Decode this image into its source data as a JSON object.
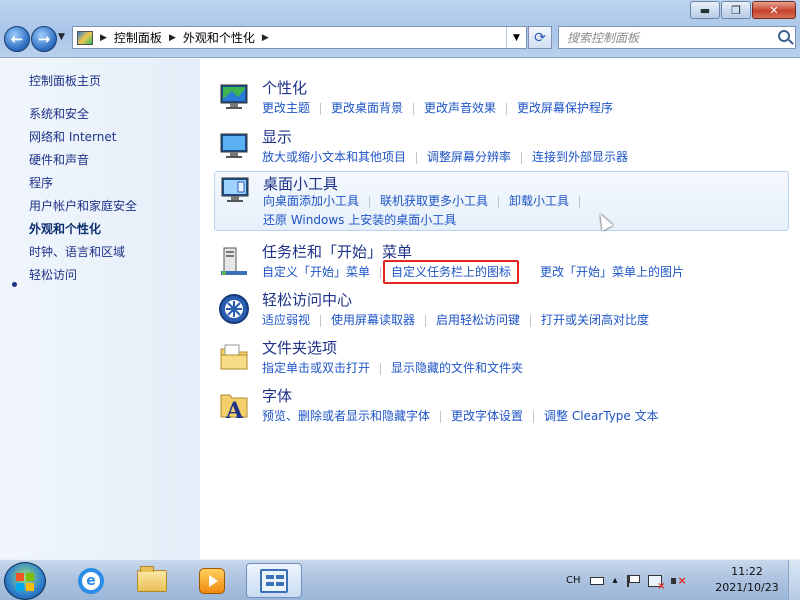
{
  "window": {
    "minimize": "▬",
    "maximize": "❐",
    "close": "✕"
  },
  "address": {
    "breadcrumb": [
      "控制面板",
      "外观和个性化"
    ]
  },
  "search": {
    "placeholder": "搜索控制面板"
  },
  "sidebar": {
    "items": [
      {
        "label": "控制面板主页"
      },
      {
        "label": "系统和安全"
      },
      {
        "label": "网络和 Internet"
      },
      {
        "label": "硬件和声音"
      },
      {
        "label": "程序"
      },
      {
        "label": "用户帐户和家庭安全"
      },
      {
        "label": "外观和个性化",
        "current": true
      },
      {
        "label": "时钟、语言和区域"
      },
      {
        "label": "轻松访问"
      }
    ]
  },
  "categories": [
    {
      "title": "个性化",
      "icon": "personalization-icon",
      "links": [
        "更改主题",
        "更改桌面背景",
        "更改声音效果",
        "更改屏幕保护程序"
      ]
    },
    {
      "title": "显示",
      "icon": "display-icon",
      "links": [
        "放大或缩小文本和其他项目",
        "调整屏幕分辨率",
        "连接到外部显示器"
      ]
    },
    {
      "title": "桌面小工具",
      "icon": "gadgets-icon",
      "links": [
        "向桌面添加小工具",
        "联机获取更多小工具",
        "卸载小工具"
      ],
      "links2": [
        "还原 Windows 上安装的桌面小工具"
      ]
    },
    {
      "title": "任务栏和「开始」菜单",
      "icon": "taskbar-icon",
      "links": [
        "自定义「开始」菜单",
        "自定义任务栏上的图标",
        "更改「开始」菜单上的图片"
      ]
    },
    {
      "title": "轻松访问中心",
      "icon": "ease-of-access-icon",
      "links": [
        "适应弱视",
        "使用屏幕读取器",
        "启用轻松访问键",
        "打开或关闭高对比度"
      ]
    },
    {
      "title": "文件夹选项",
      "icon": "folder-options-icon",
      "links": [
        "指定单击或双击打开",
        "显示隐藏的文件和文件夹"
      ]
    },
    {
      "title": "字体",
      "icon": "fonts-icon",
      "links": [
        "预览、删除或者显示和隐藏字体",
        "更改字体设置",
        "调整 ClearType 文本"
      ]
    }
  ],
  "tray": {
    "lang": "CH",
    "time": "11:22",
    "date": "2021/10/23"
  },
  "colors": {
    "highlight": "#e3261f",
    "link": "#1e54c5",
    "heading": "#1e3287"
  }
}
